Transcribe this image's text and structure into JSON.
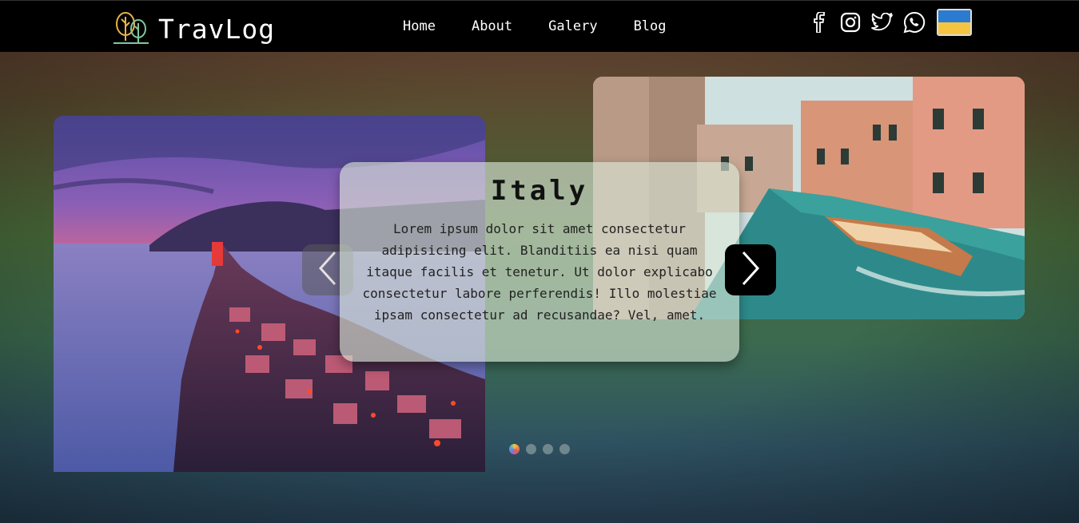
{
  "header": {
    "logo_text": "TravLog",
    "nav": [
      "Home",
      "About",
      "Galery",
      "Blog"
    ],
    "socials": [
      "facebook-icon",
      "instagram-icon",
      "twitter-icon",
      "whatsapp-icon"
    ],
    "flag_colors": {
      "top": "#2b7bd0",
      "bottom": "#f5c542"
    }
  },
  "slider": {
    "title": "Italy",
    "text": "Lorem ipsum dolor sit amet consectetur adipisicing elit. Blanditiis ea nisi quam itaque facilis et tenetur. Ut dolor explicabo consectetur labore perferendis! Illo molestiae ipsam consectetur ad recusandae? Vel, amet.",
    "prev_icon": "chevron-left-icon",
    "next_icon": "chevron-right-icon",
    "dot_count": 4,
    "active_dot": 1
  }
}
